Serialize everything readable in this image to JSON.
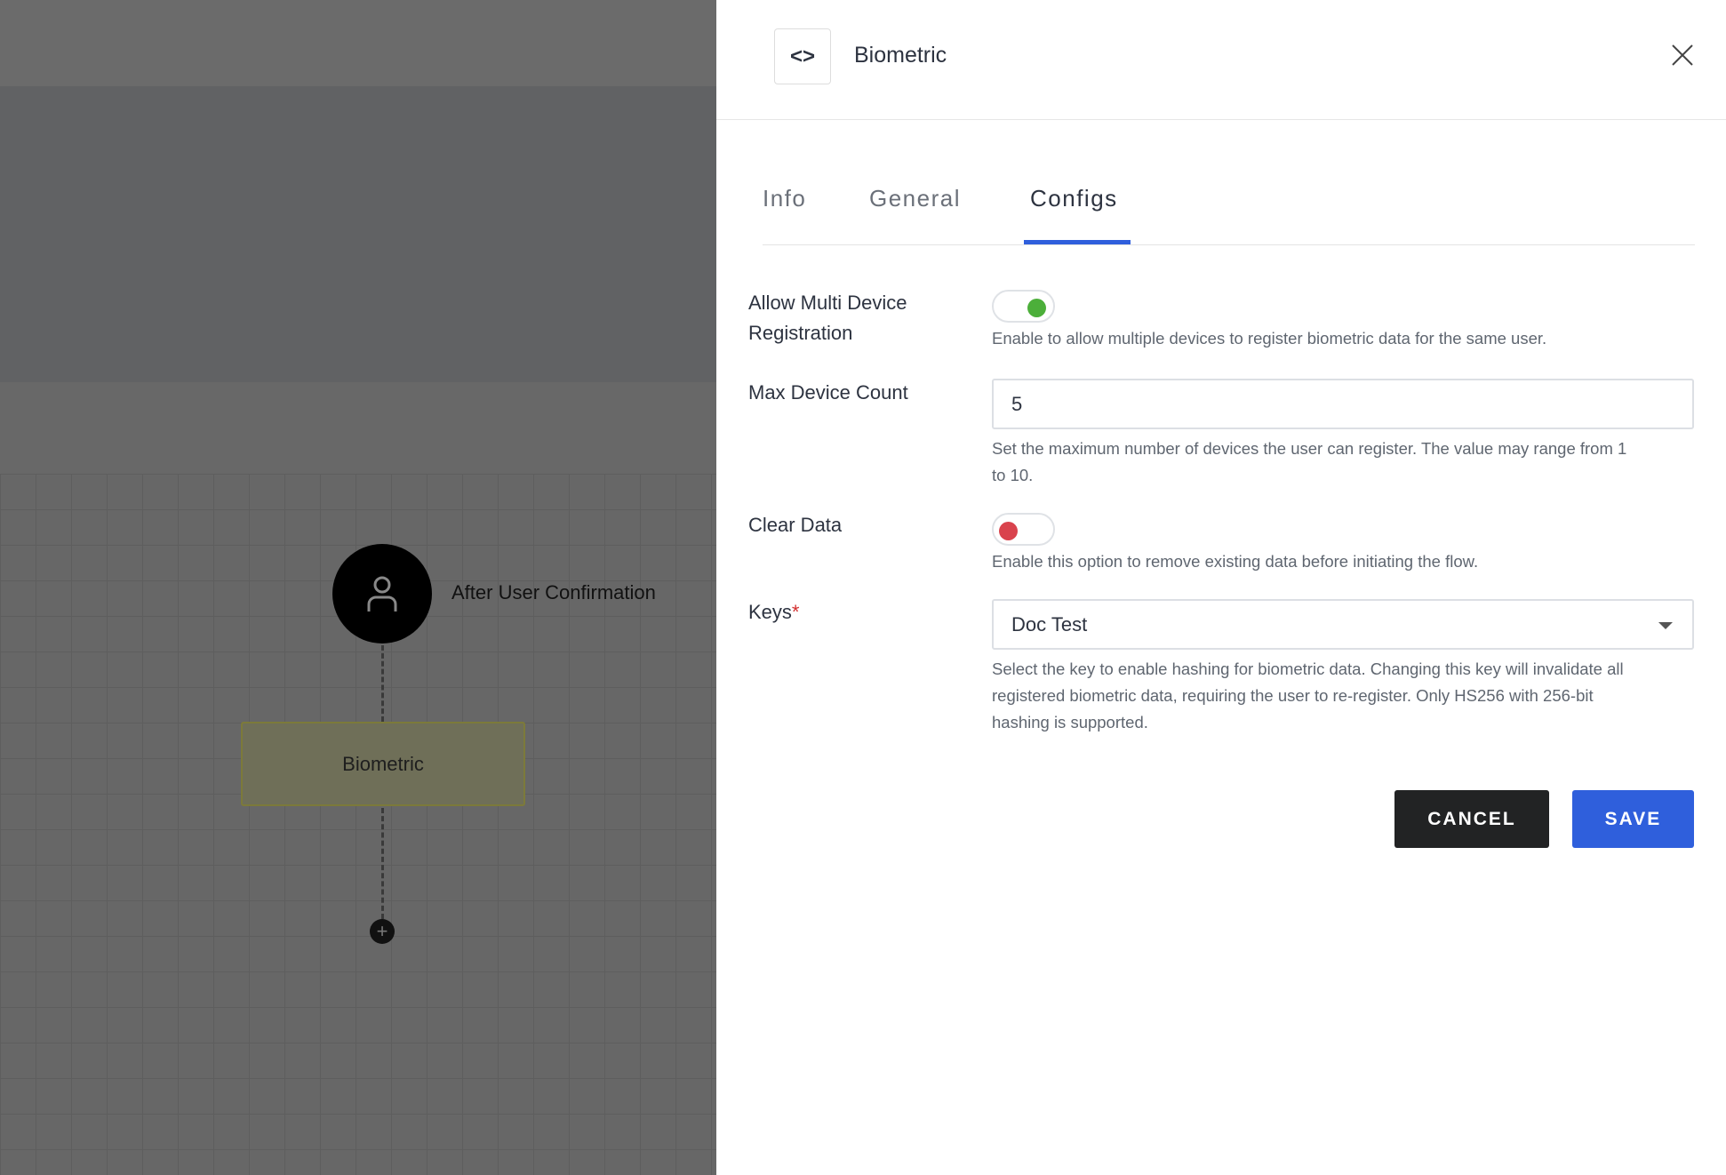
{
  "canvas": {
    "trigger_label": "After User Confirmation",
    "node_label": "Biometric"
  },
  "panel": {
    "title": "Biometric",
    "tabs": [
      {
        "label": "Info"
      },
      {
        "label": "General"
      },
      {
        "label": "Configs",
        "active": true
      }
    ],
    "fields": {
      "multi_device": {
        "label_line1": "Allow Multi Device",
        "label_line2": "Registration",
        "enabled": true,
        "help": "Enable to allow multiple devices to register biometric data for the same user."
      },
      "max_device": {
        "label": "Max Device Count",
        "value": "5",
        "help_line1": "Set the maximum number of devices the user can register. The value may range from 1",
        "help_line2": "to 10."
      },
      "clear_data": {
        "label": "Clear Data",
        "enabled": false,
        "help": "Enable this option to remove existing data before initiating the flow."
      },
      "keys": {
        "label": "Keys",
        "required_mark": "*",
        "value": "Doc Test",
        "help_line1": "Select the key to enable hashing for biometric data. Changing this key will invalidate all",
        "help_line2": "registered biometric data, requiring the user to re-register. Only HS256 with 256-bit",
        "help_line3": "hashing is supported."
      }
    },
    "cancel_label": "CANCEL",
    "save_label": "SAVE"
  },
  "colors": {
    "accent": "#2f5fdc",
    "toggle_on": "#4caf3a",
    "toggle_off": "#d9434d",
    "cancel_bg": "#222324"
  }
}
